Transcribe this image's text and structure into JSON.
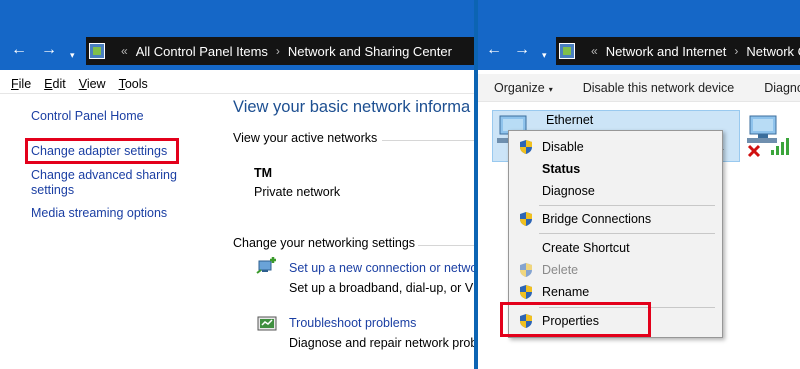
{
  "left_window": {
    "nav": {
      "back": "←",
      "forward": "→",
      "dropdown": "▾"
    },
    "breadcrumb": [
      "All Control Panel Items",
      "Network and Sharing Center"
    ],
    "breadcrumb_prefix": "«",
    "breadcrumb_sep": "›",
    "menu": [
      "File",
      "Edit",
      "View",
      "Tools"
    ],
    "sidebar": {
      "home": "Control Panel Home",
      "change_adapter": "Change adapter settings",
      "change_sharing_1": "Change advanced sharing",
      "change_sharing_2": "settings",
      "media_streaming": "Media streaming options"
    },
    "main": {
      "title": "View your basic network informa",
      "active_networks_label": "View your active networks",
      "network_name": "TM",
      "network_type": "Private network",
      "change_settings_label": "Change your networking settings",
      "task1_link": "Set up a new connection or netwo",
      "task1_desc": "Set up a broadband, dial-up, or VP",
      "task2_link": "Troubleshoot problems",
      "task2_desc": "Diagnose and repair network prob"
    }
  },
  "right_window": {
    "nav": {
      "back": "←",
      "forward": "→",
      "dropdown": "▾"
    },
    "breadcrumb": [
      "Network and Internet",
      "Network Conn"
    ],
    "breadcrumb_prefix": "«",
    "breadcrumb_sep": "›",
    "toolbar": {
      "organize": "Organize",
      "organize_arrow": "▾",
      "disable": "Disable this network device",
      "diagnose": "Diagnos"
    },
    "adapter": {
      "name": "Ethernet",
      "sub_fragment": "er"
    }
  },
  "context_menu": {
    "disable": "Disable",
    "status": "Status",
    "diagnose": "Diagnose",
    "bridge": "Bridge Connections",
    "shortcut": "Create Shortcut",
    "delete": "Delete",
    "rename": "Rename",
    "properties": "Properties"
  },
  "colors": {
    "titlebar": "#1567c7",
    "address_bar": "#141414",
    "link": "#1b3fa3",
    "highlight": "#e3001b",
    "tile_selected": "#cce4f7"
  },
  "icons": [
    "back-arrow-icon",
    "forward-arrow-icon",
    "control-panel-icon",
    "network-adapter-icon",
    "shield-icon",
    "new-connection-icon",
    "troubleshoot-icon",
    "signal-bars-icon",
    "red-x-icon"
  ]
}
